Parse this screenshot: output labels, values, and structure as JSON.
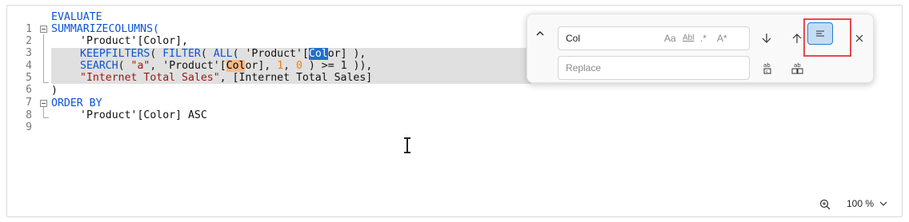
{
  "editor": {
    "lines": [
      {
        "num": "1"
      },
      {
        "num": "2"
      },
      {
        "num": "3"
      },
      {
        "num": "4"
      },
      {
        "num": "5"
      },
      {
        "num": "6"
      },
      {
        "num": "7"
      },
      {
        "num": "8"
      },
      {
        "num": "9"
      }
    ],
    "tokens": {
      "l1_evaluate": "EVALUATE",
      "l2_summarize": "SUMMARIZECOLUMNS",
      "l2_paren": "(",
      "l3_text": "'Product'[Color],",
      "l4_keepfilters": "KEEPFILTERS",
      "l4_p1": "( ",
      "l4_filter": "FILTER",
      "l4_p2": "( ",
      "l4_all": "ALL",
      "l4_p3": "( ",
      "l4_prod": "'Product'[",
      "l4_col_match": "Col",
      "l4_rest": "or] ),",
      "l5_search": "SEARCH",
      "l5_p1": "( ",
      "l5_str": "\"a\"",
      "l5_comma": ", ",
      "l5_prod": "'Product'[",
      "l5_col_match": "Col",
      "l5_rest": "or], ",
      "l5_n1": "1",
      "l5_comma2": ", ",
      "l5_n0": "0",
      "l5_end": " ) >= 1 )),",
      "l6_str": "\"Internet Total Sales\"",
      "l6_rest": ", [Internet Total Sales]",
      "l7_paren": ")",
      "l8_orderby": "ORDER BY",
      "l9_text": "'Product'[Color] ASC"
    }
  },
  "find": {
    "toggle_icon": "chevron-up-icon",
    "search_value": "Col",
    "match_case": "Aa",
    "whole_word": "Abl",
    "regex": ".*",
    "preserve_case": "A*",
    "replace_placeholder": "Replace",
    "prev_icon": "arrow-down-icon",
    "next_icon": "arrow-up-icon",
    "find_in_selection_icon": "find-in-selection-icon",
    "close_icon": "close-icon",
    "replace_one_icon": "replace-icon",
    "replace_all_icon": "replace-all-icon"
  },
  "statusbar": {
    "zoom_label": "100 %"
  },
  "colors": {
    "keyword": "#0b53d6",
    "string": "#a31515",
    "number": "#f07f12",
    "current_match": "#1e6fd0",
    "other_match": "#f5b988",
    "selection": "#e0e0e0",
    "highlight_box": "#e54a4a"
  }
}
